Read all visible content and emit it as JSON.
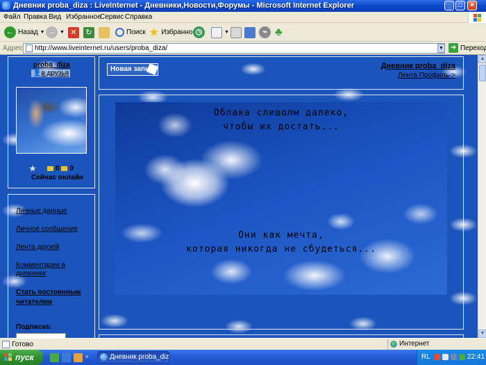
{
  "window": {
    "title": "Дневник proba_diza : LiveInternet - Дневники,Новости,Форумы - Microsoft Internet Explorer"
  },
  "menu": [
    "Файл",
    "Правка",
    "Вид",
    "Избранное",
    "Сервис",
    "Справка"
  ],
  "toolbar": {
    "back_label": "Назад",
    "search_label": "Поиск",
    "favorites_label": "Избранное"
  },
  "address": {
    "label": "Адрес:",
    "url": "http://www.liveinternet.ru/users/proba_diza/",
    "go_label": "Переход"
  },
  "sidebar": {
    "username": "proba_diza",
    "friends_link": "в друзья",
    "counter_a": "0",
    "counter_b": "0",
    "online_status": "Сейчас онлайн",
    "links": [
      "Личные данные",
      "Личное сообщение",
      "Лента друзей",
      "Комментарии в дневнике"
    ],
    "subscribe_line1": "Стать постоянным",
    "subscribe_line2": "читателем",
    "subscription_label": "Подписка:"
  },
  "header": {
    "new_post_label": "Новая запись",
    "diary_title": "Дневник proba_diza",
    "links": "Лента Профиль->"
  },
  "post": {
    "line1": "Облака слишолм далеко,",
    "line2": "чтобы их достать...",
    "line3": "Они как мечта,",
    "line4": "которая никогда не сбудеться..."
  },
  "statusbar": {
    "status": "Готово",
    "zone": "Интернет"
  },
  "taskbar": {
    "start_label": "пуск",
    "task_label": "Дневник proba_diza ...",
    "lang": "RL",
    "clock": "22:41"
  },
  "colors": {
    "titlebar": "#0a47c8",
    "page_background": "#1b55bb",
    "start_button": "#2f8f2f"
  }
}
